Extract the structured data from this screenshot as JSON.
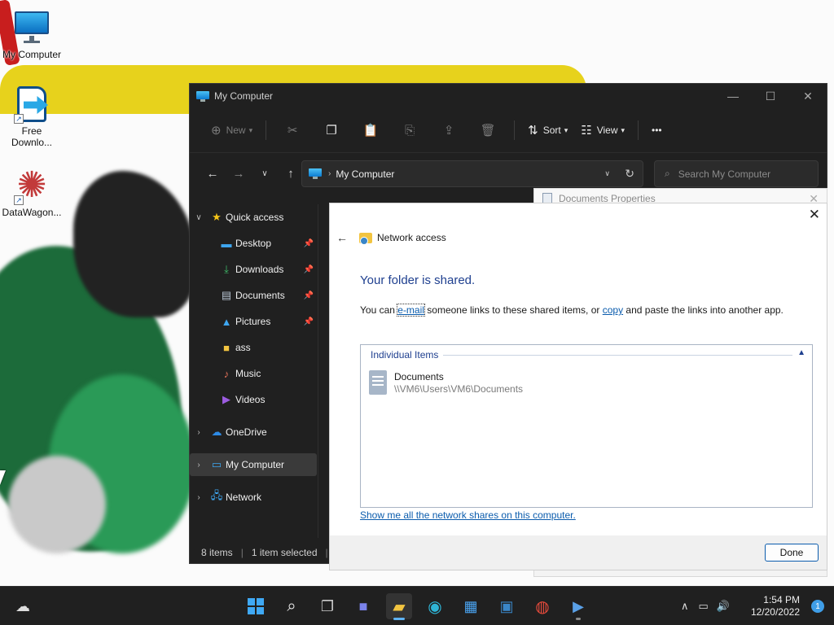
{
  "desktop": {
    "icons": [
      {
        "label": "My Computer",
        "icon": "monitor-icon"
      },
      {
        "label": "Free Downlo...",
        "icon": "free-download-manager-icon"
      },
      {
        "label": "DataWagon...",
        "icon": "datawagon-icon"
      }
    ]
  },
  "explorer": {
    "title": "My Computer",
    "window_controls": {
      "minimize": "—",
      "maximize": "☐",
      "close": "✕"
    },
    "toolbar": {
      "new_label": "New",
      "sort_label": "Sort",
      "view_label": "View",
      "more_label": "•••"
    },
    "address": {
      "crumb": "My Computer",
      "search_placeholder": "Search My Computer"
    },
    "nav": {
      "quick_access": "Quick access",
      "items": [
        {
          "label": "Desktop",
          "icon": "desktop-icon",
          "pinned": true
        },
        {
          "label": "Downloads",
          "icon": "downloads-icon",
          "pinned": true
        },
        {
          "label": "Documents",
          "icon": "documents-icon",
          "pinned": true
        },
        {
          "label": "Pictures",
          "icon": "pictures-icon",
          "pinned": true
        },
        {
          "label": "ass",
          "icon": "folder-icon",
          "pinned": false
        },
        {
          "label": "Music",
          "icon": "music-icon",
          "pinned": false
        },
        {
          "label": "Videos",
          "icon": "videos-icon",
          "pinned": false
        }
      ],
      "onedrive": "OneDrive",
      "my_computer": "My Computer",
      "network": "Network"
    },
    "status": {
      "items": "8 items",
      "selected": "1 item selected"
    }
  },
  "properties_dialog": {
    "title": "Documents Properties"
  },
  "network_dialog": {
    "header": "Network access",
    "heading": "Your folder is shared.",
    "desc_prefix": "You can ",
    "email_link": "e-mail",
    "desc_mid": " someone links to these shared items, or ",
    "copy_link": "copy",
    "desc_suffix": " and paste the links into another app.",
    "group_label": "Individual Items",
    "item_name": "Documents",
    "item_path": "\\\\VM6\\Users\\VM6\\Documents",
    "show_link": "Show me all the network shares on this computer.",
    "done_label": "Done"
  },
  "taskbar": {
    "time": "1:54 PM",
    "date": "12/20/2022",
    "notification_count": "1",
    "icons": [
      "weather-icon",
      "start-icon",
      "search-icon",
      "task-view-icon",
      "chat-icon",
      "file-explorer-icon",
      "edge-icon",
      "store-icon",
      "app-icon",
      "chrome-icon",
      "powershell-icon"
    ]
  },
  "colors": {
    "accent": "#0b5cad",
    "heading": "#1e3f8f",
    "explorer_bg": "#202020",
    "taskbar_bg": "#202020"
  }
}
